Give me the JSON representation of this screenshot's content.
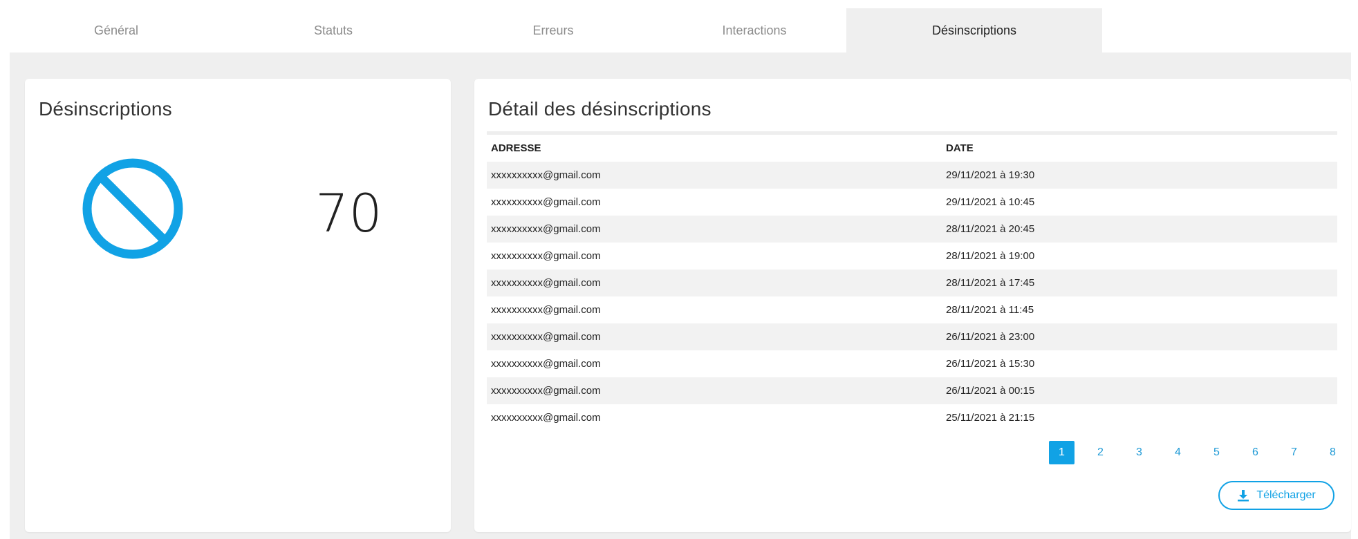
{
  "tabs": [
    {
      "label": "Général"
    },
    {
      "label": "Statuts"
    },
    {
      "label": "Erreurs"
    },
    {
      "label": "Interactions"
    },
    {
      "label": "Désinscriptions"
    }
  ],
  "summary": {
    "title": "Désinscriptions",
    "count": "70",
    "icon": "ban-icon",
    "accent_color": "#11a2e5"
  },
  "detail": {
    "title": "Détail des désinscriptions",
    "columns": {
      "address": "ADRESSE",
      "date": "DATE"
    },
    "rows": [
      {
        "address": "xxxxxxxxxx@gmail.com",
        "date": "29/11/2021 à 19:30"
      },
      {
        "address": "xxxxxxxxxx@gmail.com",
        "date": "29/11/2021 à 10:45"
      },
      {
        "address": "xxxxxxxxxx@gmail.com",
        "date": "28/11/2021 à 20:45"
      },
      {
        "address": "xxxxxxxxxx@gmail.com",
        "date": "28/11/2021 à 19:00"
      },
      {
        "address": "xxxxxxxxxx@gmail.com",
        "date": "28/11/2021 à 17:45"
      },
      {
        "address": "xxxxxxxxxx@gmail.com",
        "date": "28/11/2021 à 11:45"
      },
      {
        "address": "xxxxxxxxxx@gmail.com",
        "date": "26/11/2021 à 23:00"
      },
      {
        "address": "xxxxxxxxxx@gmail.com",
        "date": "26/11/2021 à 15:30"
      },
      {
        "address": "xxxxxxxxxx@gmail.com",
        "date": "26/11/2021 à 00:15"
      },
      {
        "address": "xxxxxxxxxx@gmail.com",
        "date": "25/11/2021 à 21:15"
      }
    ],
    "pages": [
      "1",
      "2",
      "3",
      "4",
      "5",
      "6",
      "7",
      "8"
    ],
    "current_page": "1",
    "download_label": "Télécharger",
    "download_icon": "download-icon"
  }
}
